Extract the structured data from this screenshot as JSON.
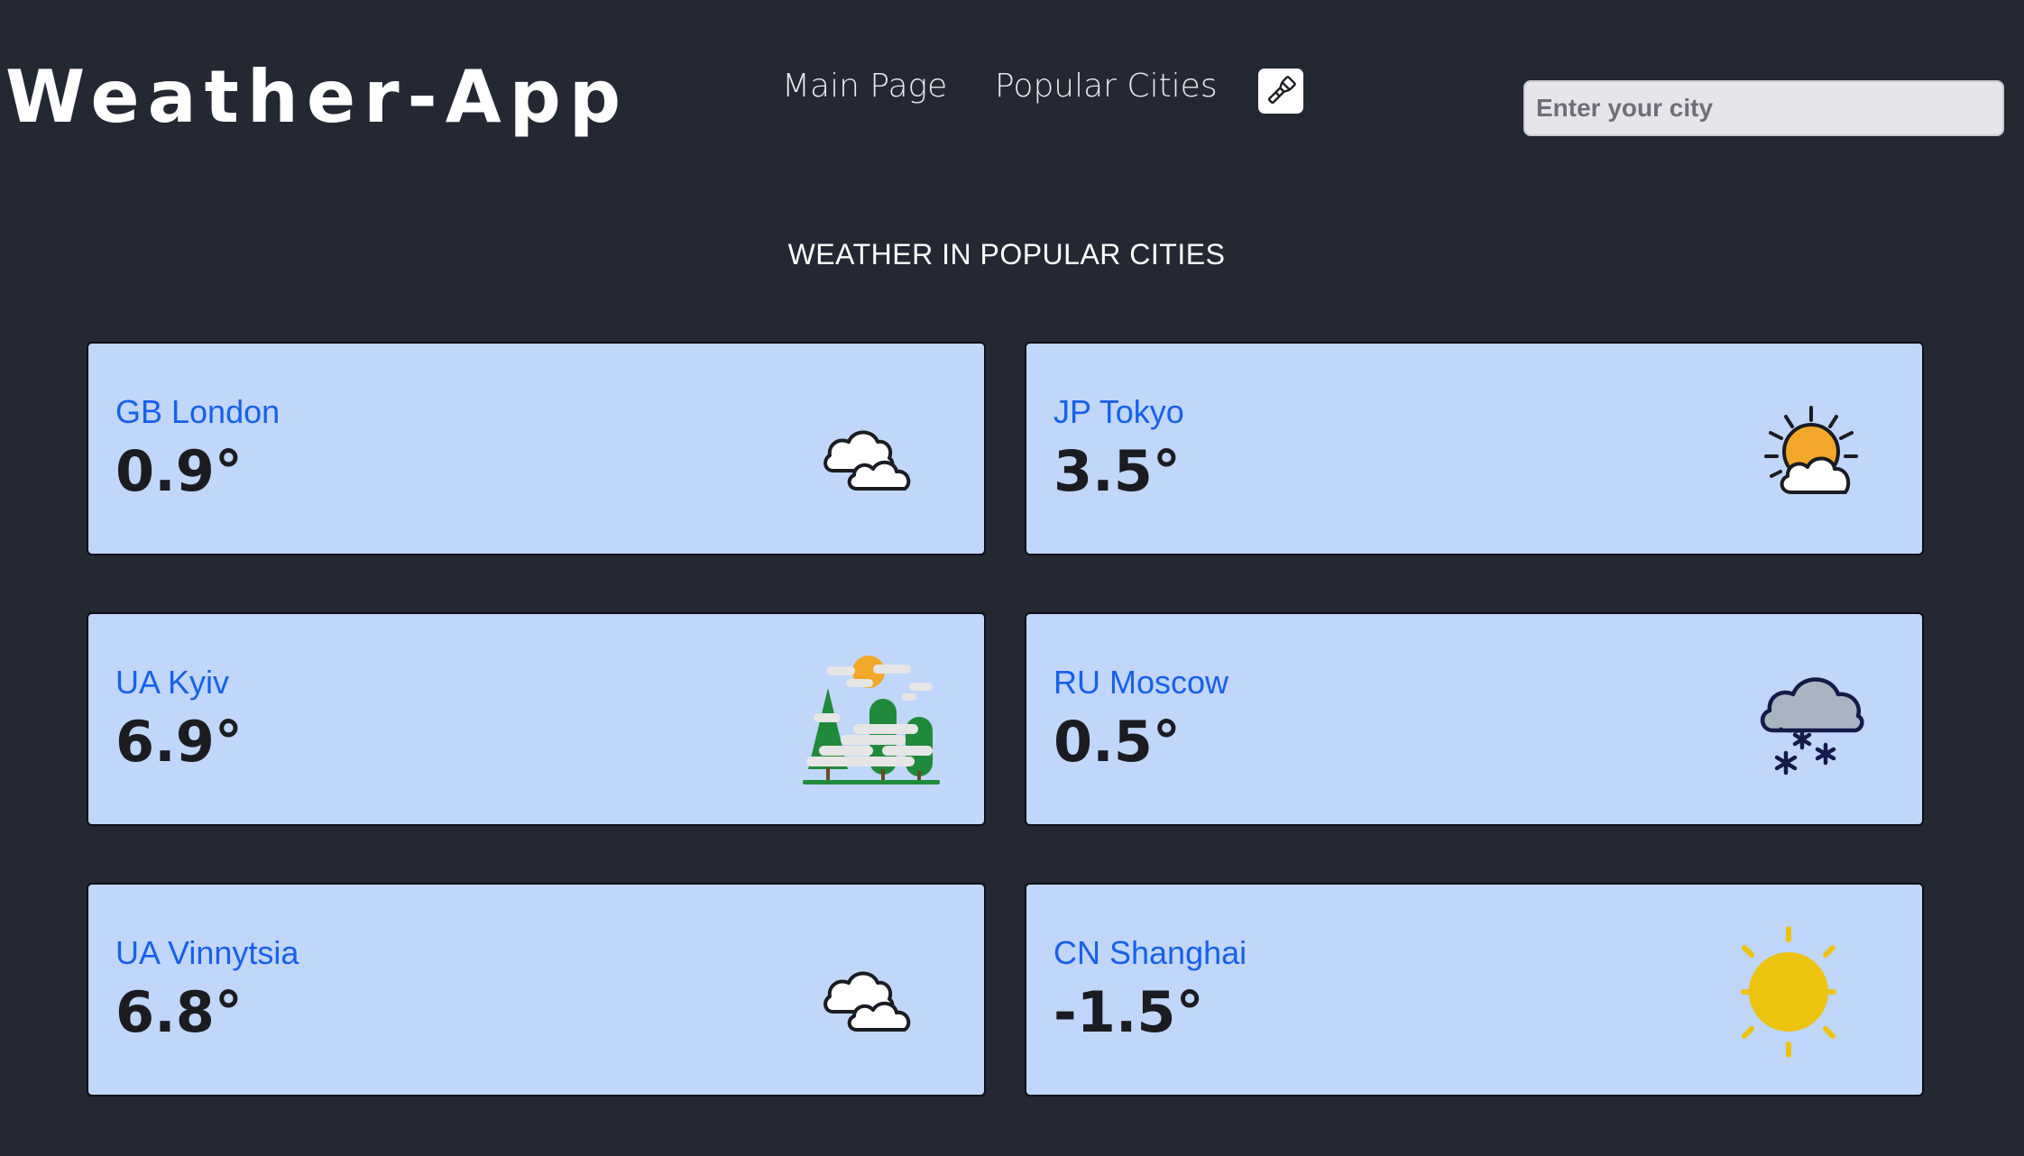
{
  "header": {
    "logo": "Weather-App",
    "nav": [
      {
        "label": "Main Page"
      },
      {
        "label": "Popular Cities"
      }
    ],
    "theme_toggle_icon": "flashlight-icon",
    "search": {
      "placeholder": "Enter your city",
      "value": ""
    }
  },
  "section_title": "WEATHER IN POPULAR CITIES",
  "cities": [
    {
      "country": "GB",
      "name": "London",
      "label": "GB London",
      "temp": "0.9°",
      "icon": "cloudy-icon"
    },
    {
      "country": "JP",
      "name": "Tokyo",
      "label": "JP Tokyo",
      "temp": "3.5°",
      "icon": "partly-sunny-icon"
    },
    {
      "country": "UA",
      "name": "Kyiv",
      "label": "UA Kyiv",
      "temp": "6.9°",
      "icon": "foggy-forest-icon"
    },
    {
      "country": "RU",
      "name": "Moscow",
      "label": "RU Moscow",
      "temp": "0.5°",
      "icon": "snow-cloud-icon"
    },
    {
      "country": "UA",
      "name": "Vinnytsia",
      "label": "UA Vinnytsia",
      "temp": "6.8°",
      "icon": "cloudy-icon"
    },
    {
      "country": "CN",
      "name": "Shanghai",
      "label": "CN Shanghai",
      "temp": "-1.5°",
      "icon": "sunny-icon"
    }
  ],
  "colors": {
    "background": "#232833",
    "card": "#c0d6fa",
    "city_text": "#1761e9",
    "temp_text": "#1a1c22",
    "sun_orange": "#f3a72a",
    "sun_yellow": "#ecc40f"
  }
}
